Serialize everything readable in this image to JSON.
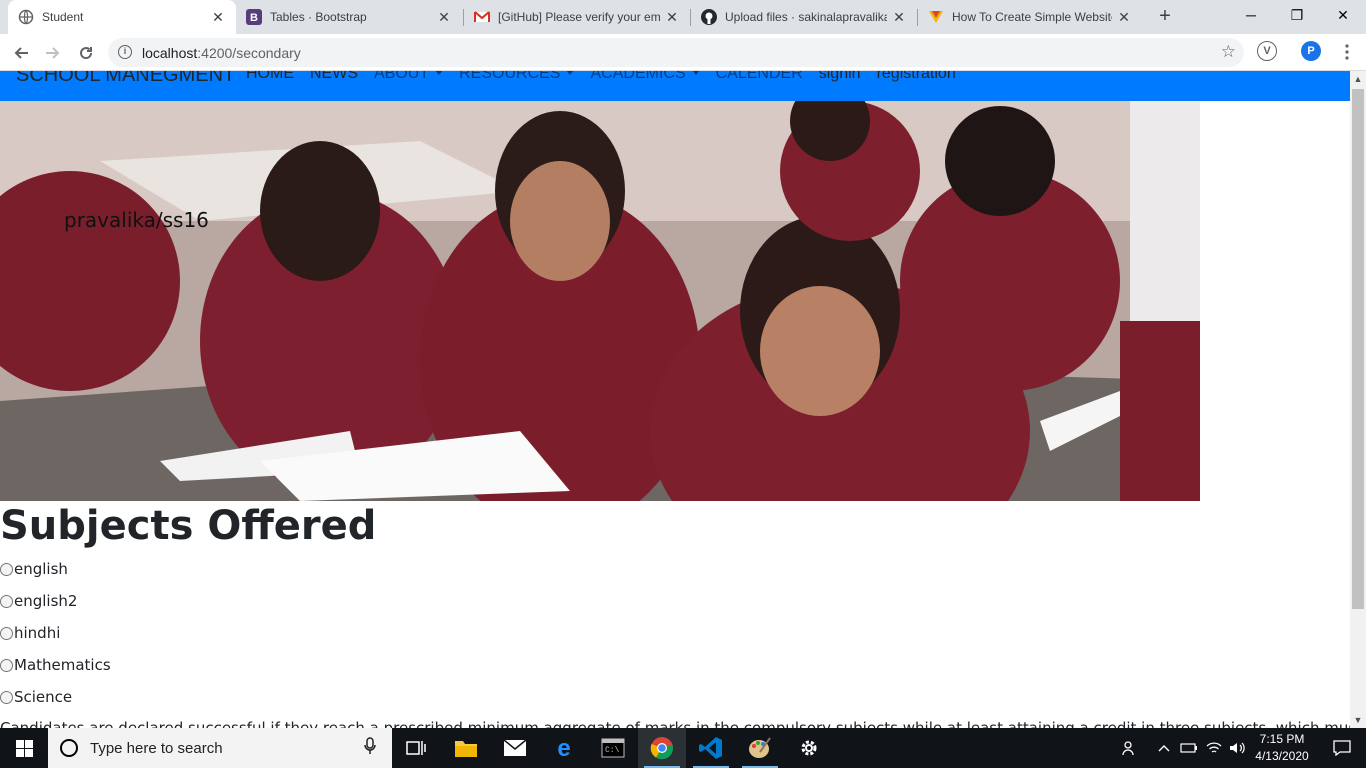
{
  "browser": {
    "tabs": [
      {
        "title": "Student",
        "icon": "globe-icon",
        "active": true
      },
      {
        "title": "Tables · Bootstrap",
        "icon": "bootstrap-icon",
        "active": false
      },
      {
        "title": "[GitHub] Please verify your em",
        "icon": "gmail-icon",
        "active": false
      },
      {
        "title": "Upload files · sakinalapravalika",
        "icon": "github-icon",
        "active": false
      },
      {
        "title": "How To Create Simple Website",
        "icon": "html-icon",
        "active": false
      }
    ],
    "url_host": "localhost",
    "url_path": ":4200/secondary",
    "profile_initial": "P",
    "extension_initial": "V"
  },
  "navbar": {
    "brand": "SCHOOL MANEGMENT",
    "links": [
      {
        "label": "HOME",
        "muted": false,
        "dropdown": false
      },
      {
        "label": "NEWS",
        "muted": false,
        "dropdown": false
      },
      {
        "label": "ABOUT",
        "muted": true,
        "dropdown": true
      },
      {
        "label": "RESOURCES",
        "muted": true,
        "dropdown": true
      },
      {
        "label": "ACADEMICS",
        "muted": true,
        "dropdown": true
      },
      {
        "label": "CALENDER",
        "muted": true,
        "dropdown": false
      },
      {
        "label": "signin",
        "muted": false,
        "dropdown": false
      },
      {
        "label": "registration",
        "muted": false,
        "dropdown": false
      }
    ],
    "color": "#007bff"
  },
  "hero": {
    "caption": "pravalika/ss16"
  },
  "main": {
    "title": "Subjects Offered",
    "subjects": [
      "english",
      "english2",
      "hindhi",
      "Mathematics",
      "Science"
    ],
    "paragraph": "Candidates are declared successful if they reach a prescribed minimum aggregate of marks in the compulsory subjects while at least attaining a credit in three subjects, which must include the"
  },
  "taskbar": {
    "search_placeholder": "Type here to search",
    "time": "7:15 PM",
    "date": "4/13/2020"
  }
}
